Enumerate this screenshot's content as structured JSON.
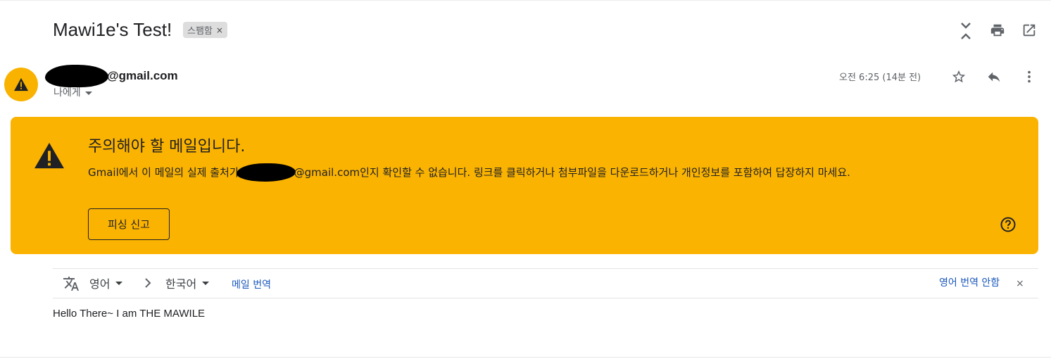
{
  "message": {
    "subject": "Mawi1e's Test!",
    "label_chip": "스팸함",
    "chip_close": "×",
    "sender_email_suffix": "@gmail.com",
    "recipient_label": "나에게",
    "timestamp": "오전 6:25 (14분 전)",
    "body": "Hello There~ I am THE MAWILE"
  },
  "header_icons": [
    "expand-collapse-icon",
    "print-icon",
    "open-in-new-window-icon"
  ],
  "action_icons": [
    "star-icon",
    "reply-icon",
    "more-vert-icon"
  ],
  "warning": {
    "title": "주의해야 할 메일입니다.",
    "text_before": "Gmail에서 이 메일의 실제 출처가",
    "text_after": "@gmail.com인지 확인할 수 없습니다. 링크를 클릭하거나 첨부파일을 다운로드하거나 개인정보를 포함하여 답장하지 마세요.",
    "button_label": "피싱 신고",
    "color": "#fbb301"
  },
  "translate": {
    "source_lang": "영어",
    "target_lang": "한국어",
    "translate_link": "메일 번역",
    "never_translate_link": "영어 번역 안함",
    "close": "×",
    "link_color": "#1a57bc"
  }
}
